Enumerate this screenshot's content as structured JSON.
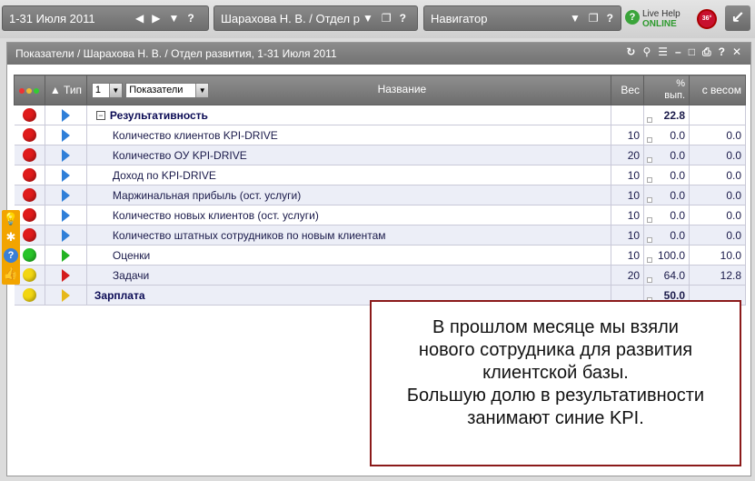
{
  "topbar": {
    "period": "1-31 Июля 2011",
    "person": "Шарахова Н. В. / Отдел р",
    "navigator": "Навигатор",
    "live_help_line1": "Live Help",
    "live_help_line2": "ONLINE",
    "badge": "36°"
  },
  "panel": {
    "title": "Показатели / Шарахова Н. В. / Отдел развития, 1-31 Июля 2011"
  },
  "table": {
    "headers": {
      "type": "▲ Тип",
      "level_select": "1",
      "view_select": "Показатели",
      "name": "Название",
      "weight": "Вес",
      "pct_line1": "%",
      "pct_line2": "вып.",
      "weighted": "с весом"
    },
    "rows": [
      {
        "light": "red",
        "flag": "blue",
        "name": "Результативность",
        "group": true,
        "weight": "",
        "pct": "22.8",
        "weighted": ""
      },
      {
        "light": "red",
        "flag": "blue",
        "name": "Количество клиентов KPI-DRIVE",
        "group": false,
        "weight": "10",
        "pct": "0.0",
        "weighted": "0.0"
      },
      {
        "light": "red",
        "flag": "blue",
        "name": "Количество ОУ KPI-DRIVE",
        "group": false,
        "weight": "20",
        "pct": "0.0",
        "weighted": "0.0"
      },
      {
        "light": "red",
        "flag": "blue",
        "name": "Доход по KPI-DRIVE",
        "group": false,
        "weight": "10",
        "pct": "0.0",
        "weighted": "0.0"
      },
      {
        "light": "red",
        "flag": "blue",
        "name": "Маржинальная прибыль (ост. услуги)",
        "group": false,
        "weight": "10",
        "pct": "0.0",
        "weighted": "0.0"
      },
      {
        "light": "red",
        "flag": "blue",
        "name": "Количество новых клиентов (ост. услуги)",
        "group": false,
        "weight": "10",
        "pct": "0.0",
        "weighted": "0.0"
      },
      {
        "light": "red",
        "flag": "blue",
        "name": "Количество штатных сотрудников по новым клиентам",
        "group": false,
        "weight": "10",
        "pct": "0.0",
        "weighted": "0.0"
      },
      {
        "light": "green",
        "flag": "green",
        "name": "Оценки",
        "group": false,
        "weight": "10",
        "pct": "100.0",
        "weighted": "10.0"
      },
      {
        "light": "yellow",
        "flag": "red",
        "name": "Задачи",
        "group": false,
        "weight": "20",
        "pct": "64.0",
        "weighted": "12.8"
      },
      {
        "light": "yellow",
        "flag": "yellow",
        "name": "Зарплата",
        "group": true,
        "weight": "",
        "pct": "50.0",
        "weighted": ""
      }
    ]
  },
  "callout": {
    "lines": [
      "В прошлом месяце мы взяли",
      "нового сотрудника для развития",
      "клиентской базы.",
      "Большую долю в результативности",
      "занимают синие KPI."
    ]
  }
}
